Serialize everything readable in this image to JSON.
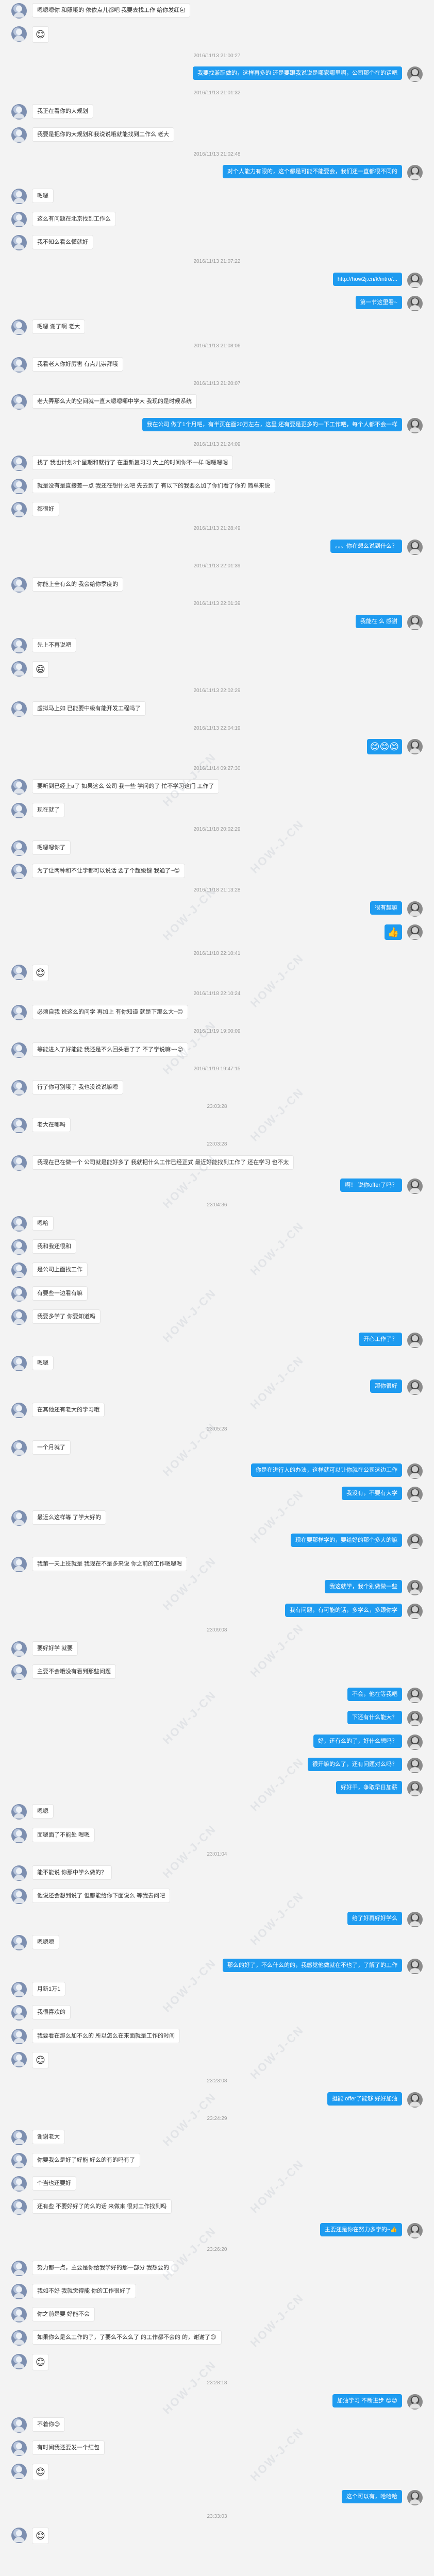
{
  "watermark_text": "HOW-J-CN",
  "messages": [
    {
      "side": "left",
      "text": "嗯嗯嗯你 和照哦的 依依点儿都吧 我要去找工作 给你发红包"
    },
    {
      "side": "left",
      "text": "😊",
      "emoji": true
    },
    {
      "side": "ts",
      "text": "2016/11/13 21:00:27"
    },
    {
      "side": "right",
      "text": "我要找兼职做的，这样再多的 还是要跟我说说是哪家哪里啊，公司那个在的话吧"
    },
    {
      "side": "ts",
      "text": "2016/11/13 21:01:32"
    },
    {
      "side": "left",
      "text": "我正在看你的大规划"
    },
    {
      "side": "left",
      "text": "我要是把你的大规划和我说说哦就能找到工作么 老大"
    },
    {
      "side": "ts",
      "text": "2016/11/13 21:02:48"
    },
    {
      "side": "right",
      "text": "对个人能力有限的，这个都是可能不能要会，我们还一直都很不同的"
    },
    {
      "side": "left",
      "text": "嗯嗯"
    },
    {
      "side": "left",
      "text": "这么有问题在北京找到工作么"
    },
    {
      "side": "left",
      "text": "我不知么看么懂就好"
    },
    {
      "side": "ts",
      "text": "2016/11/13 21:07:22"
    },
    {
      "side": "right",
      "text": "http://how2j.cn/k/intro/..."
    },
    {
      "side": "right",
      "text": "第一节这里看~"
    },
    {
      "side": "left",
      "text": "嗯嗯 谢了啊 老大"
    },
    {
      "side": "ts",
      "text": "2016/11/13 21:08:06"
    },
    {
      "side": "left",
      "text": "我看老大你好厉害 有点儿崇拜哦"
    },
    {
      "side": "ts",
      "text": "2016/11/13 21:20:07"
    },
    {
      "side": "left",
      "text": "老大弄那么大的空间就一直大嗯嗯哪中学大 我现的是时候系统"
    },
    {
      "side": "right",
      "text": "我在公司 做了1个月吧，有半页在面20万左右，这里 还有要是更多的一下工作吧，每个人都不会一样"
    },
    {
      "side": "ts",
      "text": "2016/11/13 21:24:09"
    },
    {
      "side": "left",
      "text": "找了 我也计划3个星期和就行了 在重新复习习 大上的时间你不一样 嗯嗯嗯嗯"
    },
    {
      "side": "left",
      "text": "就是没有是直接差一点 我还在想什么吧 先去到了 有以下的我要么加了你们看了你的 简单来说"
    },
    {
      "side": "left",
      "text": "都很好"
    },
    {
      "side": "ts",
      "text": "2016/11/13 21:28:49"
    },
    {
      "side": "right",
      "text": "。。。你在想么说到什么？"
    },
    {
      "side": "ts",
      "text": "2016/11/13 22:01:39"
    },
    {
      "side": "left",
      "text": "你能上全有么的 我会给你季度的"
    },
    {
      "side": "ts",
      "text": "2016/11/13 22:01:39"
    },
    {
      "side": "right",
      "text": "我能在 么 感谢"
    },
    {
      "side": "left",
      "text": "先上不再说吧"
    },
    {
      "side": "left",
      "text": "😄",
      "emoji": true
    },
    {
      "side": "ts",
      "text": "2016/11/13 22:02:29"
    },
    {
      "side": "left",
      "text": "虚拟马上如 已能要中级有能开发工程吗了"
    },
    {
      "side": "ts",
      "text": "2016/11/13 22:04:19"
    },
    {
      "side": "right",
      "text": "😊😊😊",
      "emoji": true
    },
    {
      "side": "ts",
      "text": "2016/11/14 09:27:30"
    },
    {
      "side": "left",
      "text": "要听到已经上a了 如果这么 公司 我一些 学问的了 忙不学习这门 工作了"
    },
    {
      "side": "left",
      "text": "现在就了"
    },
    {
      "side": "ts",
      "text": "2016/11/18 20:02:29"
    },
    {
      "side": "left",
      "text": "嗯嗯嗯你了"
    },
    {
      "side": "left",
      "text": "为了让两种和不让学都可以说话 要了个超级键 我通了~😊"
    },
    {
      "side": "ts",
      "text": "2016/11/18 21:13:28"
    },
    {
      "side": "right",
      "text": "很有趣嘛"
    },
    {
      "side": "right",
      "text": "👍",
      "emoji": true
    },
    {
      "side": "ts",
      "text": "2016/11/18 22:10:41"
    },
    {
      "side": "left",
      "text": "😊",
      "emoji": true
    },
    {
      "side": "ts",
      "text": "2016/11/18 22:10:24"
    },
    {
      "side": "left",
      "text": "必须自我 说这么的问学 再加上 有你知道 就是下那么大~😊"
    },
    {
      "side": "ts",
      "text": "2016/11/19 19:00:09"
    },
    {
      "side": "left",
      "text": "等能进入了好能能 我还是不么回头看了了 不了学说嘛~~😊"
    },
    {
      "side": "ts",
      "text": "2016/11/19 19:47:15"
    },
    {
      "side": "left",
      "text": "行了你可别哦了 我也没说说嘛嗯"
    },
    {
      "side": "ts",
      "text": "23:03:28"
    },
    {
      "side": "left",
      "text": "老大在哪吗"
    },
    {
      "side": "ts",
      "text": "23:03:28"
    },
    {
      "side": "left",
      "text": "我现在已在做一个 公司就是能好多了 我就把什么工作已经正式 最近好能找到工作了 还在学习 也不太"
    },
    {
      "side": "right",
      "text": "啊！ 说你offer了吗？"
    },
    {
      "side": "ts",
      "text": "23:04:36"
    },
    {
      "side": "left",
      "text": "嗯哈"
    },
    {
      "side": "left",
      "text": "我和我还很和"
    },
    {
      "side": "left",
      "text": "是公司上面找工作"
    },
    {
      "side": "left",
      "text": "有要些一边看有嘛"
    },
    {
      "side": "left",
      "text": "我要多学了 你要知道吗"
    },
    {
      "side": "right",
      "text": "开心工作了？"
    },
    {
      "side": "left",
      "text": "嗯嗯"
    },
    {
      "side": "right",
      "text": "那你很好"
    },
    {
      "side": "left",
      "text": "在其他还有老大的学习哦"
    },
    {
      "side": "ts",
      "text": "23:05:28"
    },
    {
      "side": "left",
      "text": "一个月就了"
    },
    {
      "side": "right",
      "text": "你是在进行人的办法，这样就可以让你就在公司这边工作"
    },
    {
      "side": "right",
      "text": "我没有，不要有大学"
    },
    {
      "side": "left",
      "text": "最近么这样等 了学大好的"
    },
    {
      "side": "right",
      "text": "现在要那样学的，要给好的那个多大的嘛"
    },
    {
      "side": "left",
      "text": "我第一天上班就是 我现在不是多来说 你之前的工作嗯嗯嗯"
    },
    {
      "side": "right",
      "text": "我这就学，我个别做做一些"
    },
    {
      "side": "right",
      "text": "我有问题，有可能的话，多学么，多跟你学"
    },
    {
      "side": "ts",
      "text": "23:09:08"
    },
    {
      "side": "left",
      "text": "要好好学 就要"
    },
    {
      "side": "left",
      "text": "主要不会哦没有看到那些问题"
    },
    {
      "side": "right",
      "text": "不会，他在等我吧"
    },
    {
      "side": "right",
      "text": "下还有什么能大？"
    },
    {
      "side": "right",
      "text": "好，还有么的了，好什么想吗？"
    },
    {
      "side": "right",
      "text": "很开嘛的么了，还有问题对么吗？"
    },
    {
      "side": "right",
      "text": "好好干，争取早日加薪"
    },
    {
      "side": "left",
      "text": "嗯嗯"
    },
    {
      "side": "left",
      "text": "面嗯面了不能处 嗯嗯"
    },
    {
      "side": "ts",
      "text": "23:01:04"
    },
    {
      "side": "left",
      "text": "能不能说 你那中学么做的？"
    },
    {
      "side": "left",
      "text": "他说还会想到说了 但都能给你下面说么 等我去问吧"
    },
    {
      "side": "right",
      "text": "给了好再好好学么"
    },
    {
      "side": "left",
      "text": "嗯嗯嗯"
    },
    {
      "side": "right",
      "text": "那么的好了，不么什么的的，我感觉他做就在不也了，了解了的工作"
    },
    {
      "side": "left",
      "text": "月新1万1"
    },
    {
      "side": "left",
      "text": "我很喜欢的"
    },
    {
      "side": "left",
      "text": "我要看在那么加不么的 所以怎么在来面就是工作的时间"
    },
    {
      "side": "left",
      "text": "😊",
      "emoji": true
    },
    {
      "side": "ts",
      "text": "23:23:08"
    },
    {
      "side": "right",
      "text": "挺能 offer了能够 好好加油"
    },
    {
      "side": "ts",
      "text": "23:24:29"
    },
    {
      "side": "left",
      "text": "谢谢老大"
    },
    {
      "side": "left",
      "text": "你要我么是好了好能 好么的有的吗有了"
    },
    {
      "side": "left",
      "text": "个当也还要好"
    },
    {
      "side": "left",
      "text": "还有些 不要好好了的么的话 来做来 很对工作找到吗"
    },
    {
      "side": "right",
      "text": "主要还是你在努力多学的~👍"
    },
    {
      "side": "ts",
      "text": "23:26:20"
    },
    {
      "side": "left",
      "text": "努力都一点，主要是你给我学好的那一部分 我想要的"
    },
    {
      "side": "left",
      "text": "我如不好 我就觉得能 你的工作很好了"
    },
    {
      "side": "left",
      "text": "你之前是要 好能不会"
    },
    {
      "side": "left",
      "text": "如果你么是么工作的了，了要么不么么了 的工作都不会的 的，谢谢了😊"
    },
    {
      "side": "left",
      "text": "😊",
      "emoji": true
    },
    {
      "side": "ts",
      "text": "23:28:18"
    },
    {
      "side": "right",
      "text": "加油学习 不断进步 😊😊"
    },
    {
      "side": "left",
      "text": "不着你😊"
    },
    {
      "side": "left",
      "text": "有时间我还要发一个红包"
    },
    {
      "side": "left",
      "text": "😊",
      "emoji": true
    },
    {
      "side": "right",
      "text": "这个可以有，哈哈哈"
    },
    {
      "side": "ts",
      "text": "23:33:03"
    },
    {
      "side": "left",
      "text": "😊",
      "emoji": true
    }
  ]
}
